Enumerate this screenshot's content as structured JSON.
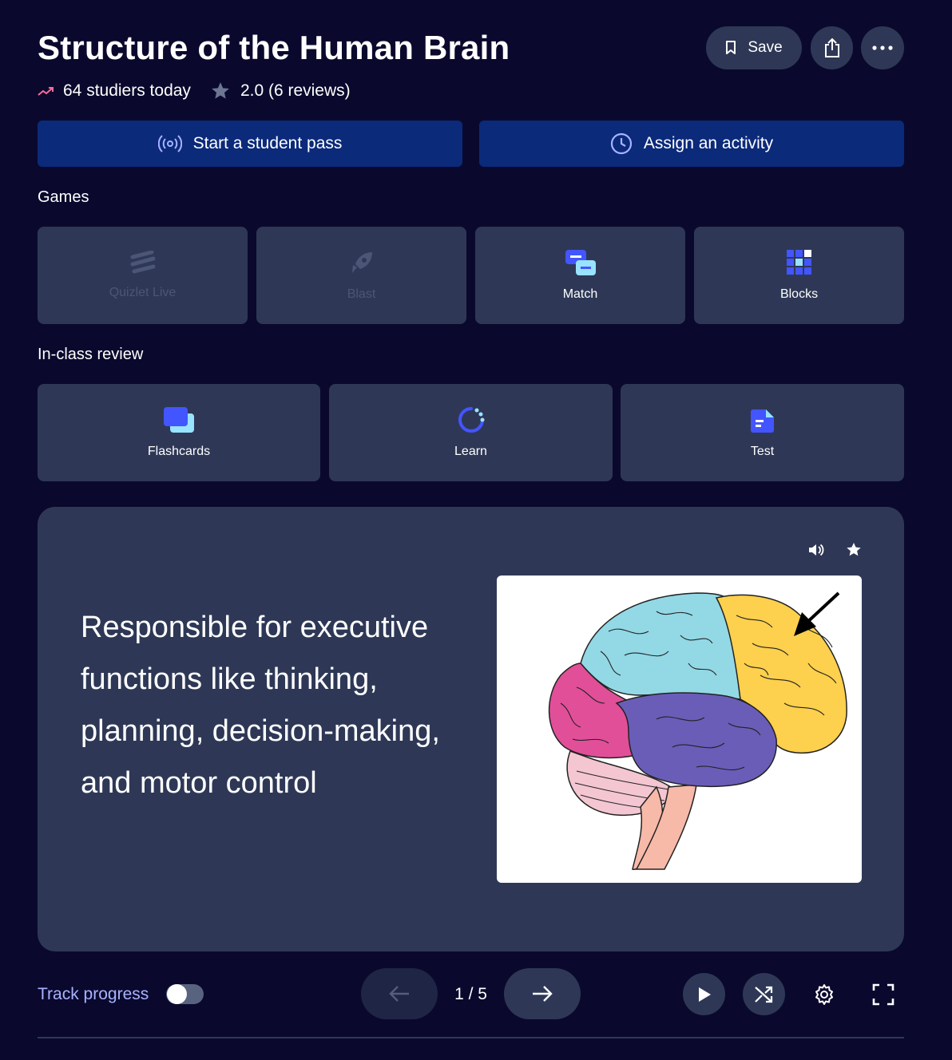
{
  "header": {
    "title": "Structure of the Human Brain",
    "studiers": "64 studiers today",
    "rating": "2.0 (6 reviews)",
    "save_label": "Save"
  },
  "actions": {
    "student_pass": "Start a student pass",
    "assign": "Assign an activity"
  },
  "games": {
    "label": "Games",
    "items": [
      {
        "label": "Quizlet Live",
        "enabled": false
      },
      {
        "label": "Blast",
        "enabled": false
      },
      {
        "label": "Match",
        "enabled": true
      },
      {
        "label": "Blocks",
        "enabled": true
      }
    ]
  },
  "review": {
    "label": "In-class review",
    "items": [
      {
        "label": "Flashcards"
      },
      {
        "label": "Learn"
      },
      {
        "label": "Test"
      }
    ]
  },
  "flashcard": {
    "text": "Responsible for executive functions like thinking, planning, decision-making, and motor control",
    "image": "brain-diagram-frontal-lobe-highlighted"
  },
  "controls": {
    "track_progress": "Track progress",
    "track_enabled": false,
    "counter": "1 / 5"
  },
  "colors": {
    "background": "#0a092d",
    "surface": "#2e3856",
    "primary_button": "#0b2a7a",
    "accent": "#4255ff",
    "link": "#a8b3ff"
  }
}
